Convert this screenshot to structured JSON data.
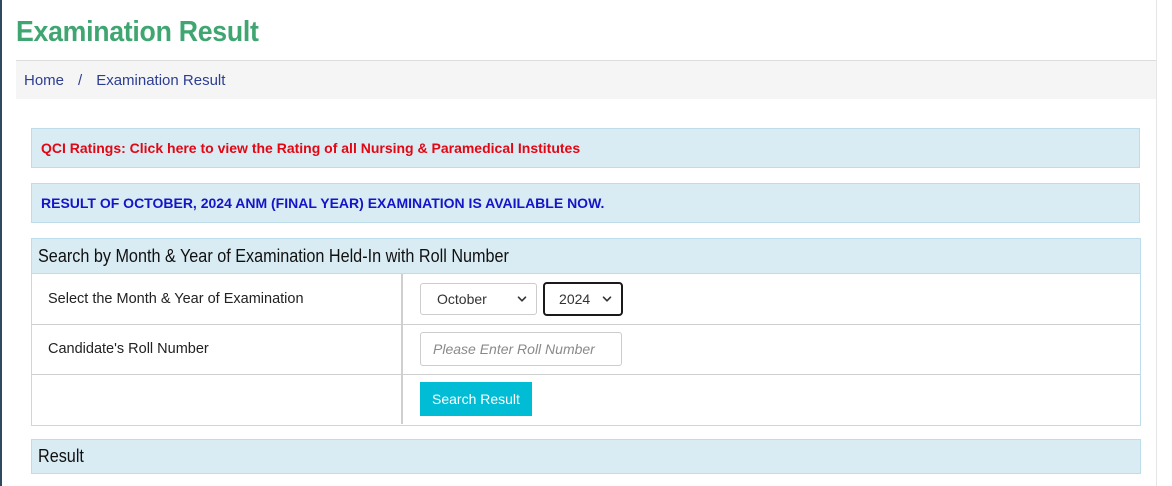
{
  "page": {
    "title": "Examination Result"
  },
  "breadcrumb": {
    "home": "Home",
    "separator": "/",
    "current": "Examination Result"
  },
  "alerts": {
    "qci": "QCI Ratings: Click here to view the Rating of all Nursing & Paramedical Institutes",
    "announcement": "RESULT OF OCTOBER, 2024 ANM (FINAL YEAR) EXAMINATION IS AVAILABLE NOW."
  },
  "search_panel": {
    "heading": "Search by Month & Year of Examination Held-In with Roll Number",
    "month_year_label": "Select the Month & Year of Examination",
    "month_selected": "October",
    "year_selected": "2024",
    "roll_label": "Candidate's Roll Number",
    "roll_value": "",
    "roll_placeholder": "Please Enter Roll Number",
    "search_button": "Search Result"
  },
  "result_panel": {
    "heading": "Result"
  },
  "colors": {
    "title_green": "#3fa671",
    "alert_red": "#e30613",
    "alert_blue": "#1414c8",
    "panel_bg": "#d9ecf4",
    "button_cyan": "#00bcd4",
    "breadcrumb_link": "#2c3e91"
  },
  "icons": {
    "select_arrow": "chevron-down-icon"
  }
}
